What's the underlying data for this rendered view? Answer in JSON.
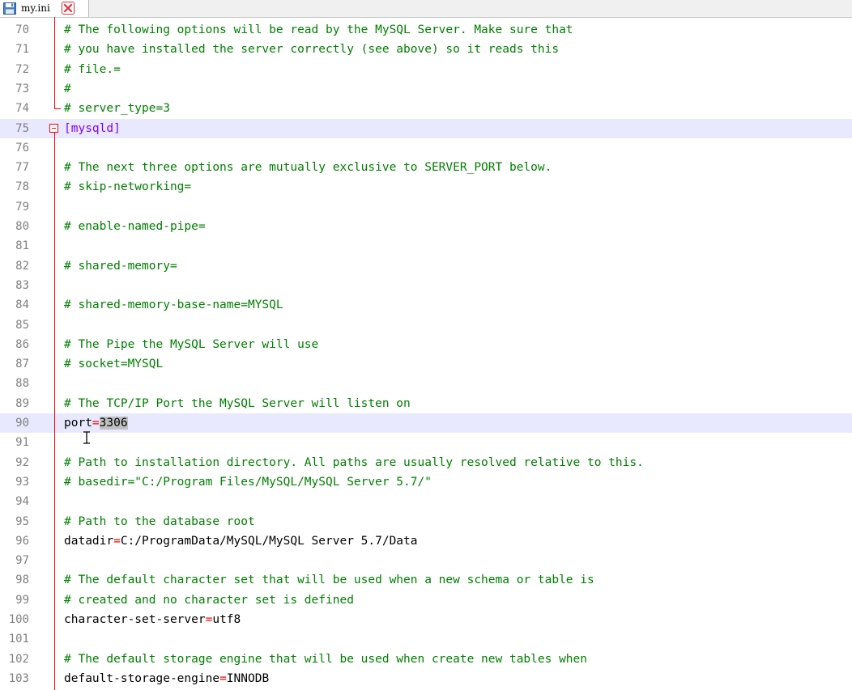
{
  "tab": {
    "filename": "my.ini",
    "save_icon": "save-floppy-icon",
    "close_icon": "close-x-icon",
    "close_color": "#e0303a"
  },
  "colors": {
    "comment": "#008000",
    "section": "#8000ff",
    "operator": "#ff0000",
    "line_number": "#808080",
    "current_line": "#e8e8ff",
    "fold_marker": "#ff0000",
    "selection": "#c0c0c0"
  },
  "lines": [
    {
      "n": "70",
      "c": "# The following options will be read by the MySQL Server. Make sure that"
    },
    {
      "n": "71",
      "c": "# you have installed the server correctly (see above) so it reads this"
    },
    {
      "n": "72",
      "c": "# file.="
    },
    {
      "n": "73",
      "c": "#"
    },
    {
      "n": "74",
      "c": "# server_type=3"
    },
    {
      "n": "75",
      "s": "[mysqld]"
    },
    {
      "n": "76"
    },
    {
      "n": "77",
      "c": "# The next three options are mutually exclusive to SERVER_PORT below."
    },
    {
      "n": "78",
      "c": "# skip-networking="
    },
    {
      "n": "79"
    },
    {
      "n": "80",
      "c": "# enable-named-pipe="
    },
    {
      "n": "81"
    },
    {
      "n": "82",
      "c": "# shared-memory="
    },
    {
      "n": "83"
    },
    {
      "n": "84",
      "c": "# shared-memory-base-name=MYSQL"
    },
    {
      "n": "85"
    },
    {
      "n": "86",
      "c": "# The Pipe the MySQL Server will use"
    },
    {
      "n": "87",
      "c": "# socket=MYSQL"
    },
    {
      "n": "88"
    },
    {
      "n": "89",
      "c": "# The TCP/IP Port the MySQL Server will listen on"
    },
    {
      "n": "90",
      "k": "port",
      "v": "3306"
    },
    {
      "n": "91"
    },
    {
      "n": "92",
      "c": "# Path to installation directory. All paths are usually resolved relative to this."
    },
    {
      "n": "93",
      "c": "# basedir=\"C:/Program Files/MySQL/MySQL Server 5.7/\""
    },
    {
      "n": "94"
    },
    {
      "n": "95",
      "c": "# Path to the database root"
    },
    {
      "n": "96",
      "k": "datadir",
      "v": "C:/ProgramData/MySQL/MySQL Server 5.7/Data"
    },
    {
      "n": "97"
    },
    {
      "n": "98",
      "c": "# The default character set that will be used when a new schema or table is"
    },
    {
      "n": "99",
      "c": "# created and no character set is defined"
    },
    {
      "n": "100",
      "k": "character-set-server",
      "v": "utf8"
    },
    {
      "n": "101"
    },
    {
      "n": "102",
      "c": "# The default storage engine that will be used when create new tables when"
    },
    {
      "n": "103",
      "k": "default-storage-engine",
      "v": "INNODB"
    }
  ],
  "editor": {
    "highlighted_lines": [
      "75",
      "90"
    ],
    "selected_value_line": "90",
    "fold_marker_line": "75",
    "caret_line": "90"
  }
}
